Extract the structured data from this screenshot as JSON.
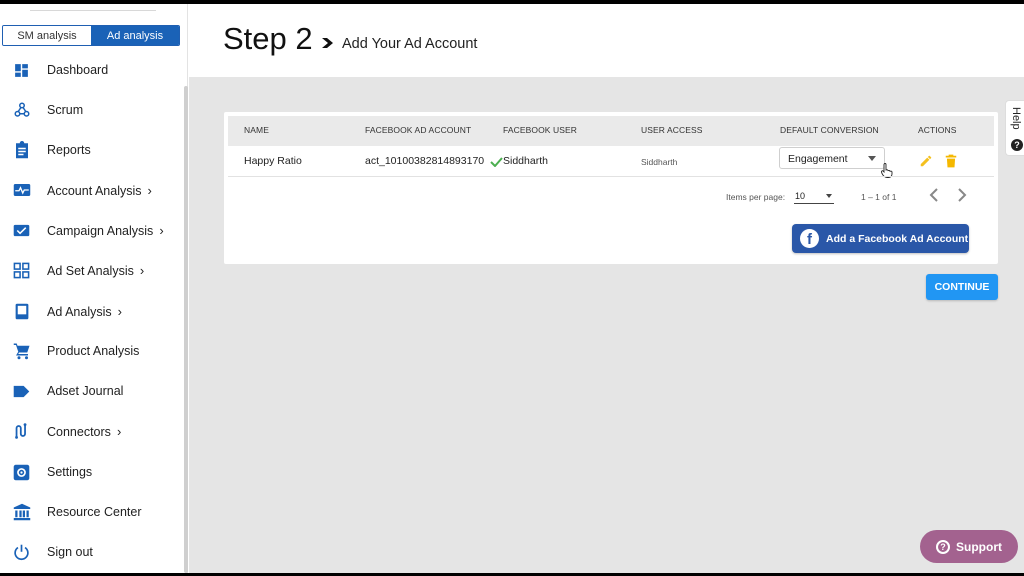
{
  "sidebar": {
    "toggle": {
      "sm_label": "SM analysis",
      "ad_label": "Ad analysis",
      "active": "ad"
    },
    "accent_color": "#1a62b7",
    "items": [
      {
        "label": "Dashboard",
        "icon": "dashboard-icon",
        "has_chevron": false
      },
      {
        "label": "Scrum",
        "icon": "webhook-icon",
        "has_chevron": false
      },
      {
        "label": "Reports",
        "icon": "clipboard-icon",
        "has_chevron": false
      },
      {
        "label": "Account Analysis",
        "icon": "pulse-icon",
        "has_chevron": true
      },
      {
        "label": "Campaign Analysis",
        "icon": "checkbox-icon",
        "has_chevron": true
      },
      {
        "label": "Ad Set Analysis",
        "icon": "grid-icon",
        "has_chevron": true
      },
      {
        "label": "Ad Analysis",
        "icon": "monitor-icon",
        "has_chevron": true
      },
      {
        "label": "Product Analysis",
        "icon": "cart-icon",
        "has_chevron": false
      },
      {
        "label": "Adset Journal",
        "icon": "label-icon",
        "has_chevron": false
      },
      {
        "label": "Connectors",
        "icon": "connector-icon",
        "has_chevron": true
      },
      {
        "label": "Settings",
        "icon": "gear-icon",
        "has_chevron": false
      },
      {
        "label": "Resource Center",
        "icon": "bank-icon",
        "has_chevron": false
      },
      {
        "label": "Sign out",
        "icon": "power-icon",
        "has_chevron": false
      }
    ],
    "chevron_glyph": "›"
  },
  "header": {
    "title": "Step 2",
    "subtitle": "Add Your Ad Account"
  },
  "help_tab": {
    "label": "Help",
    "icon_glyph": "?"
  },
  "table": {
    "columns": [
      "NAME",
      "FACEBOOK AD ACCOUNT",
      "FACEBOOK USER",
      "USER ACCESS",
      "DEFAULT CONVERSION",
      "ACTIONS"
    ],
    "rows": [
      {
        "name": "Happy Ratio",
        "ad_account": "act_10100382814893170",
        "facebook_user": "Siddharth",
        "user_access": "Siddharth",
        "default_conversion": "Engagement"
      }
    ]
  },
  "pagination": {
    "items_per_page_label": "Items per page:",
    "items_per_page": "10",
    "range": "1 – 1 of 1"
  },
  "buttons": {
    "add_facebook": "Add a Facebook Ad Account",
    "continue": "CONTINUE",
    "support": "Support",
    "support_icon": "?",
    "facebook_glyph": "f"
  },
  "colors": {
    "primary_blue": "#2196f3",
    "facebook_blue": "#2a57a8",
    "support_purple": "#a3628f",
    "edit_yellow": "#f4c01e",
    "delete_yellow": "#f5b800",
    "check_green": "#4caf50"
  }
}
